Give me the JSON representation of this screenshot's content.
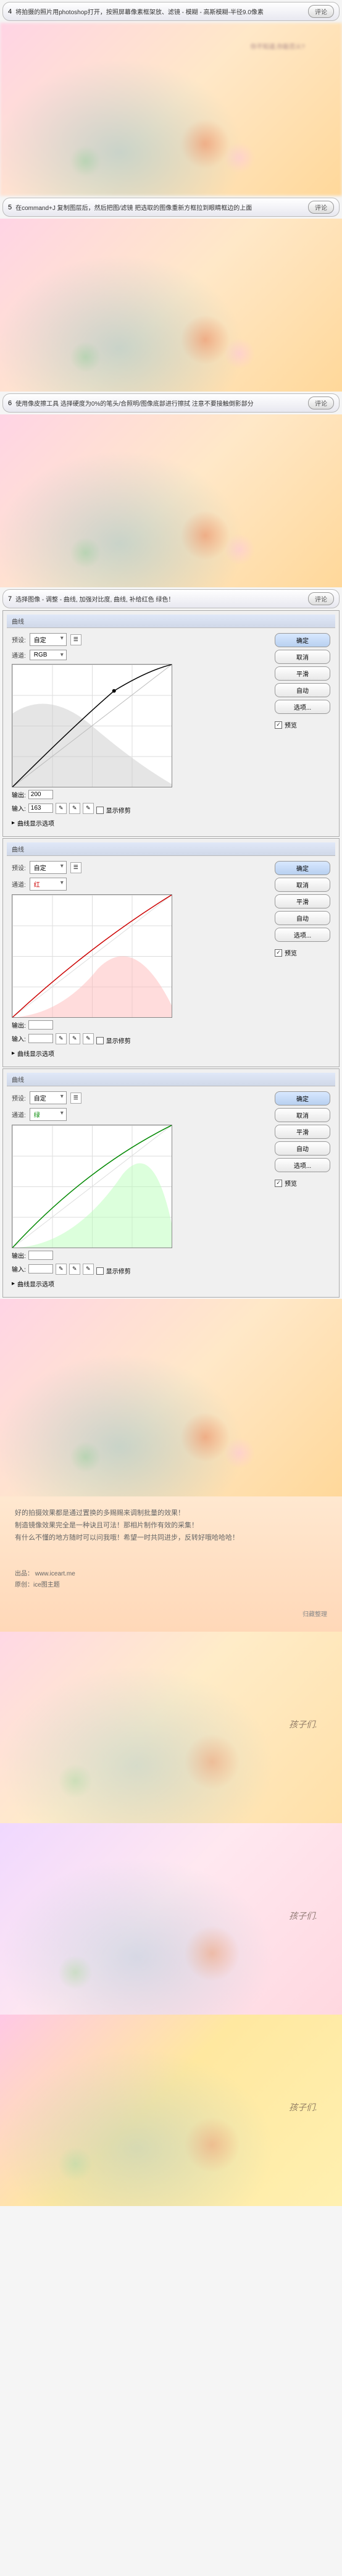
{
  "steps": {
    "s4": {
      "num": "4",
      "text": "将拍摄的照片用photoshop打开，按照屏幕像素框架放、滤镜 - 模糊 - 高斯模糊-半径9.0像素",
      "btn": "评论"
    },
    "s5": {
      "num": "5",
      "text": "在command+J 复制图层后，然后把图/滤镜  把选取的图像重新方框拉到眼睛框边的上面",
      "btn": "评论"
    },
    "s6": {
      "num": "6",
      "text": "使用像皮擦工具 选择硬度为0%的笔头/合照明/图像底部进行擦拭 注意不要接触倒影部分",
      "btn": "评论"
    },
    "s7": {
      "num": "7",
      "text": "选择图像 - 调整 - 曲线, 加强对比度, 曲线, 补给红色 绿色！",
      "btn": "评论"
    }
  },
  "photo_note": "你不知道,你能否火?",
  "curves": {
    "title": "曲线",
    "preset_label": "预设:",
    "preset_value": "自定",
    "channel_label": "通道:",
    "btn_ok": "确定",
    "btn_cancel": "取消",
    "btn_smooth": "平滑",
    "btn_auto": "自动",
    "btn_options": "选项...",
    "chk_preview": "预览",
    "output_label": "输出:",
    "input_label": "输入:",
    "show_clip": "显示修剪",
    "curve_options": "曲线显示选项",
    "rgb": {
      "channel": "RGB",
      "output": "200",
      "input": "163"
    },
    "red": {
      "channel": "红",
      "output": "",
      "input": ""
    },
    "green": {
      "channel": "绿",
      "output": "",
      "input": ""
    }
  },
  "ending": {
    "line1": "好的拍摄效果都是通过置换的多赐赐来调制批量的效果！",
    "line2": "制造镜像效果完全是一种诀且可法！那相片制作有效的采集！",
    "line3": "有什么不懂的地方随时可以问我哦！希望一时共同进步，反转好哦哈哈哈！",
    "credit_label": "出品：",
    "credit_url": "www.iceart.me",
    "credit_by": "原创：ice图主题",
    "footer": "归藏整理"
  },
  "chart_data": [
    {
      "type": "line",
      "title": "RGB 曲线",
      "series": [
        {
          "name": "曲线",
          "points": [
            [
              0,
              0
            ],
            [
              163,
              200
            ],
            [
              255,
              255
            ]
          ]
        }
      ],
      "xlabel": "输入",
      "ylabel": "输出",
      "xlim": [
        0,
        255
      ],
      "ylim": [
        0,
        255
      ],
      "histogram": "暗部密集向亮部递减"
    },
    {
      "type": "line",
      "title": "红 曲线",
      "series": [
        {
          "name": "曲线",
          "points": [
            [
              0,
              0
            ],
            [
              128,
              140
            ],
            [
              255,
              255
            ]
          ]
        }
      ],
      "xlabel": "输入",
      "ylabel": "输出",
      "xlim": [
        0,
        255
      ],
      "ylim": [
        0,
        255
      ],
      "histogram": "中亮部集中"
    },
    {
      "type": "line",
      "title": "绿 曲线",
      "series": [
        {
          "name": "曲线",
          "points": [
            [
              0,
              0
            ],
            [
              128,
              150
            ],
            [
              255,
              255
            ]
          ]
        }
      ],
      "xlabel": "输入",
      "ylabel": "输出",
      "xlim": [
        0,
        255
      ],
      "ylim": [
        0,
        255
      ],
      "histogram": "亮部集中"
    }
  ],
  "caption": "孩子们."
}
